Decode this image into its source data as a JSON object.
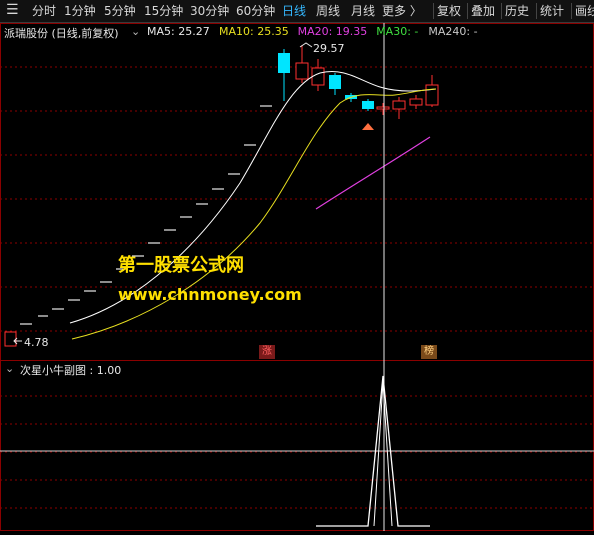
{
  "toolbar": {
    "items": [
      "分时",
      "1分钟",
      "5分钟",
      "15分钟",
      "30分钟",
      "60分钟",
      "日线",
      "周线",
      "月线",
      "更多 〉"
    ],
    "active": "日线",
    "right_items": [
      "复权",
      "叠加",
      "历史",
      "统计",
      "画线"
    ]
  },
  "main": {
    "stock_title": "派瑞股份 (日线,前复权)",
    "ma_labels": [
      {
        "text": "MA5: 25.27",
        "color": "#e8e8e8"
      },
      {
        "text": "MA10: 25.35",
        "color": "#e8e020"
      },
      {
        "text": "MA20: 19.35",
        "color": "#e040e0"
      },
      {
        "text": "MA30: -",
        "color": "#40e040"
      },
      {
        "text": "MA240: -",
        "color": "#c8c8c8"
      }
    ],
    "high_label": "29.57",
    "low_label": "4.78",
    "badge_zhang": "涨",
    "badge_bang": "榜",
    "watermark_line1": "第一股票公式网",
    "watermark_line2": "www.chnmoney.com"
  },
  "sub": {
    "indicator_title": "次星小牛副图 : 1.00"
  },
  "colors": {
    "bg": "#000000",
    "grid": "#8b0000",
    "up": "#ff3030",
    "down": "#00e5ff",
    "ma5": "#ffffff",
    "ma10": "#e8e020",
    "ma20": "#e040e0",
    "watermark": "#ffe000"
  },
  "chart_data": {
    "type": "candlestick",
    "price_extremes": {
      "high": 29.57,
      "low": 4.78
    },
    "moving_averages": {
      "MA5": 25.27,
      "MA10": 25.35,
      "MA20": 19.35
    },
    "indicator": {
      "name": "次星小牛副图",
      "value": 1.0
    }
  }
}
